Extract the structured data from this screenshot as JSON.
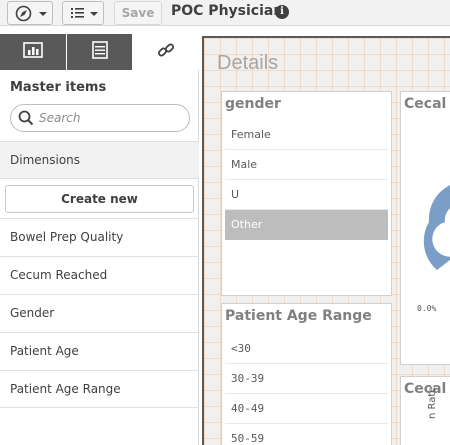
{
  "toolbar": {
    "app_title": "POC Physician",
    "save_label": "Save",
    "info_glyph": "i",
    "icons": {
      "navigate": "compass-icon",
      "list": "list-icon"
    }
  },
  "asset_panel": {
    "tabs": [
      {
        "icon": "chart-icon"
      },
      {
        "icon": "list-icon"
      },
      {
        "icon": "link-icon"
      }
    ],
    "master_items_title": "Master items",
    "search_placeholder": "Search",
    "dimensions_header": "Dimensions",
    "create_new_label": "Create new",
    "dimensions": [
      "Bowel Prep Quality",
      "Cecum Reached",
      "Gender",
      "Patient Age",
      "Patient Age Range"
    ]
  },
  "sheet": {
    "title": "Details",
    "gender_filter": {
      "title": "gender",
      "values": [
        "Female",
        "Male",
        "U",
        "Other"
      ]
    },
    "age_filter": {
      "title": "Patient Age Range",
      "values": [
        "<30",
        "30-39",
        "40-49",
        "50-59"
      ]
    },
    "cecal_chart_1": {
      "title": "Cecal I",
      "label": "0.0%",
      "color": "#7b9ec6"
    },
    "cecal_chart_2": {
      "title": "Cecal I",
      "axis_label": "n Rate"
    }
  },
  "colors": {
    "tab_dark": "#595959",
    "selected_alt": "#bdbdbd",
    "chart_blue": "#7b9ec6"
  }
}
